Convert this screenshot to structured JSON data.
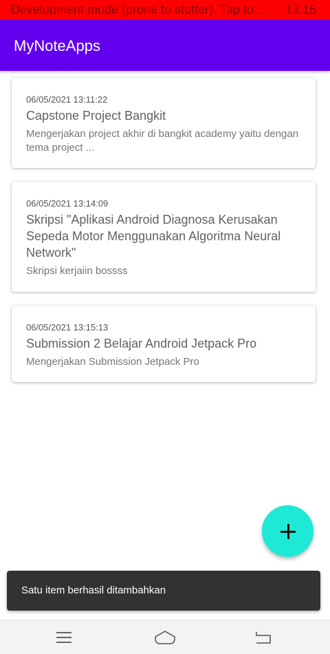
{
  "dev_banner": {
    "message": "Development mode (prone to stutter). Tap to...",
    "time": "13:15"
  },
  "app_bar": {
    "title": "MyNoteApps",
    "color": "#6200ee"
  },
  "notes": [
    {
      "date": "06/05/2021 13:11:22",
      "title": "Capstone Project Bangkit",
      "description": "Mengerjakan project akhir di bangkit academy yaitu dengan tema project ..."
    },
    {
      "date": "06/05/2021 13:14:09",
      "title": "Skripsi \"Aplikasi Android Diagnosa Kerusakan Sepeda Motor Menggunakan Algoritma Neural Network\"",
      "description": "Skripsi kerjaiin bossss"
    },
    {
      "date": "06/05/2021 13:15:13",
      "title": "Submission 2 Belajar Android Jetpack Pro",
      "description": "Mengerjakan Submission Jetpack Pro"
    }
  ],
  "fab": {
    "icon": "plus-icon",
    "color": "#1de9d6"
  },
  "snackbar": {
    "message": "Satu item berhasil ditambahkan"
  },
  "system_nav": {
    "menu_icon": "menu-icon",
    "home_icon": "home-icon",
    "back_icon": "back-icon"
  }
}
